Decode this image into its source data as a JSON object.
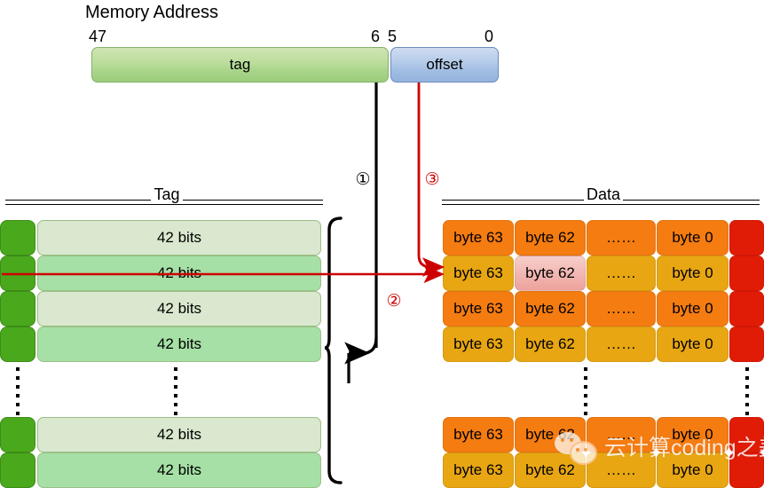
{
  "memory_address": {
    "title": "Memory Address",
    "bit_labels": {
      "high": "47",
      "tag_low": "6",
      "offset_high": "5",
      "offset_low": "0"
    },
    "fields": [
      {
        "name": "tag",
        "label": "tag",
        "color": "#9ccd7c"
      },
      {
        "name": "offset",
        "label": "offset",
        "color": "#94b3dd"
      }
    ]
  },
  "steps": [
    {
      "id": "1",
      "label": "①",
      "color": "#000000"
    },
    {
      "id": "2",
      "label": "②",
      "color": "#cc0000"
    },
    {
      "id": "3",
      "label": "③",
      "color": "#cc0000"
    }
  ],
  "tag_table": {
    "header": "Tag",
    "rows": [
      {
        "valid": "",
        "value": "42 bits",
        "shade": "light"
      },
      {
        "valid": "",
        "value": "42 bits",
        "shade": "dark"
      },
      {
        "valid": "",
        "value": "42 bits",
        "shade": "light"
      },
      {
        "valid": "",
        "value": "42 bits",
        "shade": "dark"
      },
      {
        "valid": "",
        "value": "42 bits",
        "shade": "light"
      },
      {
        "valid": "",
        "value": "42 bits",
        "shade": "dark"
      }
    ],
    "ellipsis_after_row": 4,
    "valid_color": "#4aa81c",
    "light_color": "#d9e8ce",
    "dark_color": "#a6e0a6"
  },
  "data_table": {
    "header": "Data",
    "columns": [
      "byte 63",
      "byte 62",
      "……",
      "byte 0",
      ""
    ],
    "rows": [
      {
        "cells": [
          "byte 63",
          "byte 62",
          "……",
          "byte 0",
          ""
        ],
        "shade": "orange",
        "highlight_col": -1
      },
      {
        "cells": [
          "byte 63",
          "byte 62",
          "……",
          "byte 0",
          ""
        ],
        "shade": "amber",
        "highlight_col": 1
      },
      {
        "cells": [
          "byte 63",
          "byte 62",
          "……",
          "byte 0",
          ""
        ],
        "shade": "orange",
        "highlight_col": -1
      },
      {
        "cells": [
          "byte 63",
          "byte 62",
          "……",
          "byte 0",
          ""
        ],
        "shade": "amber",
        "highlight_col": -1
      },
      {
        "cells": [
          "byte 63",
          "byte 62",
          "……",
          "byte 0",
          ""
        ],
        "shade": "orange",
        "highlight_col": -1
      },
      {
        "cells": [
          "byte 63",
          "byte 62",
          "……",
          "byte 0",
          ""
        ],
        "shade": "amber",
        "highlight_col": -1
      }
    ],
    "ellipsis_after_row": 4,
    "orange_color": "#f57c11",
    "amber_color": "#e8a613",
    "red_color": "#e01b06",
    "highlight_color": "#f1b3ae"
  },
  "watermark": {
    "text": "云计算coding之美",
    "logo": "wechat-logo"
  }
}
